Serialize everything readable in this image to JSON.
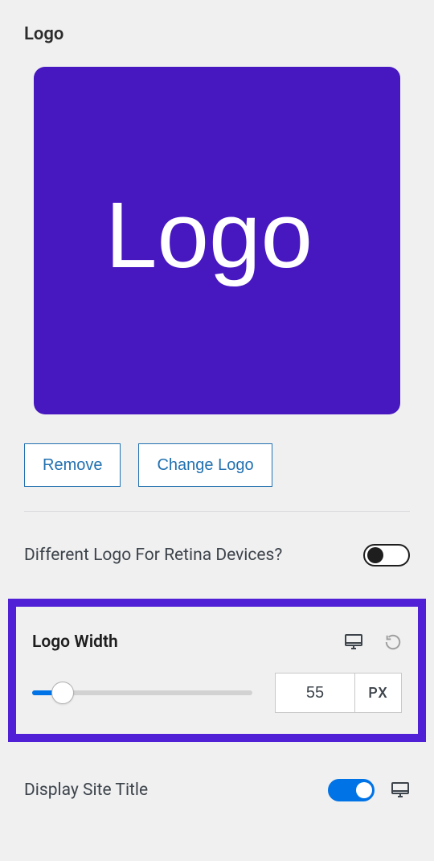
{
  "logo": {
    "title": "Logo",
    "preview_text": "Logo",
    "remove_label": "Remove",
    "change_label": "Change Logo"
  },
  "retina": {
    "label": "Different Logo For Retina Devices?",
    "enabled": false
  },
  "logo_width": {
    "label": "Logo Width",
    "value": "55",
    "unit": "PX",
    "min": 0,
    "max": 400,
    "fill_percent": 14
  },
  "site_title": {
    "label": "Display Site Title",
    "enabled": true
  }
}
